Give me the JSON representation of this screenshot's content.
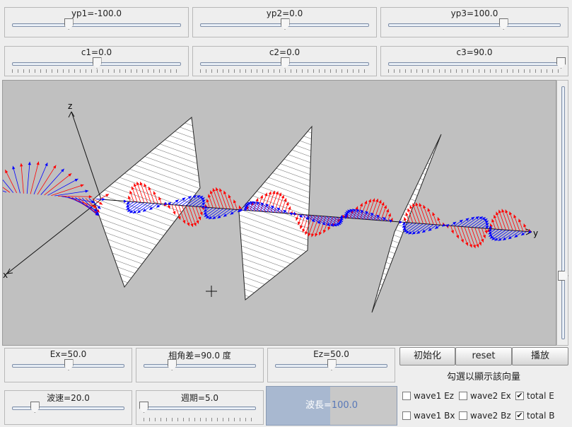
{
  "sliders_top": [
    {
      "label": "yp1=-100.0",
      "value": -100.0,
      "min": -300,
      "max": 300
    },
    {
      "label": "yp2=0.0",
      "value": 0.0,
      "min": -300,
      "max": 300
    },
    {
      "label": "yp3=100.0",
      "value": 100.0,
      "min": -300,
      "max": 300
    }
  ],
  "sliders_phase": [
    {
      "label": "c1=0.0",
      "value": 0.0,
      "min": -90,
      "max": 90
    },
    {
      "label": "c2=0.0",
      "value": 0.0,
      "min": -90,
      "max": 90
    },
    {
      "label": "c3=90.0",
      "value": 90.0,
      "min": -90,
      "max": 90
    }
  ],
  "axes": {
    "x": "x",
    "y": "y",
    "z": "z"
  },
  "sliders_bottom": [
    {
      "label": "Ex=50.0",
      "value": 50.0,
      "min": 0,
      "max": 100
    },
    {
      "label": "相角差=90.0 度",
      "value": 90.0,
      "min": 0,
      "max": 360
    },
    {
      "label": "Ez=50.0",
      "value": 50.0,
      "min": 0,
      "max": 100
    },
    {
      "label": "波速=20.0",
      "value": 20.0,
      "min": 0,
      "max": 100
    },
    {
      "label": "週期=5.0",
      "value": 5.0,
      "min": 5,
      "max": 100
    }
  ],
  "buttons": {
    "init": "初始化",
    "reset": "reset",
    "play": "播放"
  },
  "hint": "勾選以顯示該向量",
  "checkboxes": [
    {
      "label": "wave1 Ez",
      "checked": false
    },
    {
      "label": "wave2 Ex",
      "checked": false
    },
    {
      "label": "total E",
      "checked": true
    },
    {
      "label": "wave1 Bx",
      "checked": false
    },
    {
      "label": "wave2 Bz",
      "checked": false
    },
    {
      "label": "total B",
      "checked": true
    }
  ],
  "wavelength": {
    "prefix": "波長=",
    "value": "100.0",
    "fraction": 0.49
  },
  "colors": {
    "e_field": "#ff0000",
    "b_field": "#0000ff",
    "canvas_bg": "#c0c0c0"
  }
}
